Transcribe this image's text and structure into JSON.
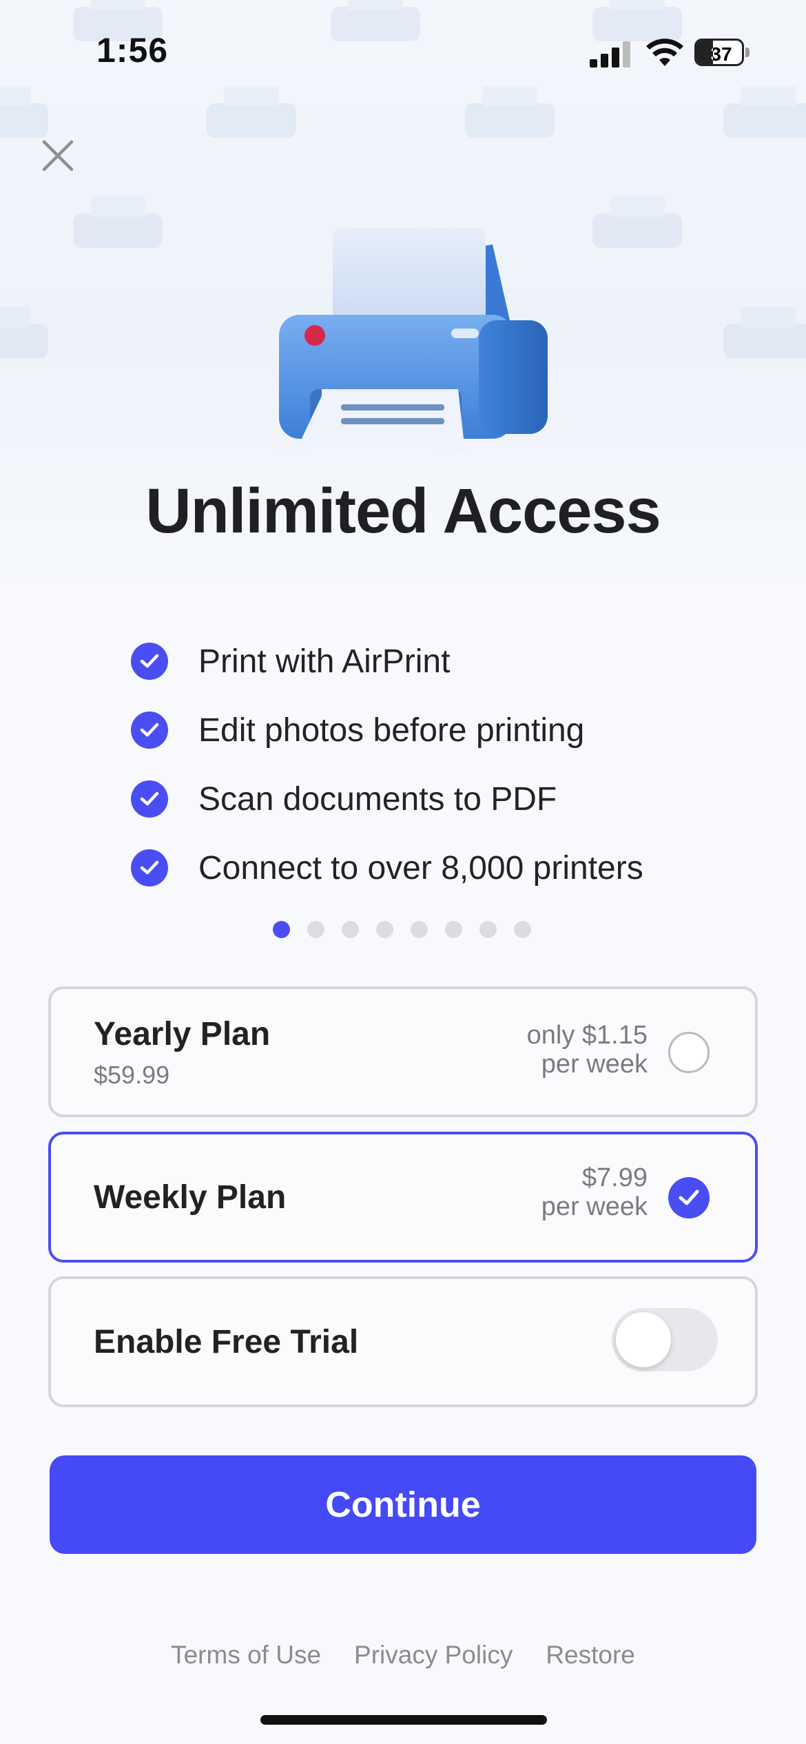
{
  "status_bar": {
    "time": "1:56",
    "battery_level": "37",
    "battery_fraction": 0.37,
    "icons": [
      "cellular-signal-icon",
      "wifi-icon",
      "battery-icon"
    ]
  },
  "close": {
    "icon": "close-icon"
  },
  "hero": {
    "illustration": "printer-icon",
    "title": "Unlimited Access"
  },
  "features": [
    {
      "label": "Print with AirPrint",
      "icon": "check-icon"
    },
    {
      "label": "Edit photos before printing",
      "icon": "check-icon"
    },
    {
      "label": "Scan documents to PDF",
      "icon": "check-icon"
    },
    {
      "label": "Connect to over 8,000 printers",
      "icon": "check-icon"
    }
  ],
  "pagination": {
    "count": 8,
    "active_index": 0
  },
  "plans": {
    "yearly": {
      "name": "Yearly Plan",
      "sub": "$59.99",
      "price_line1": "only $1.15",
      "price_line2": "per week",
      "selected": false
    },
    "weekly": {
      "name": "Weekly Plan",
      "price_line1": "$7.99",
      "price_line2": "per week",
      "selected": true
    },
    "trial": {
      "name": "Enable Free Trial",
      "enabled": false
    }
  },
  "cta": {
    "continue_label": "Continue"
  },
  "footer": {
    "terms": "Terms of Use",
    "privacy": "Privacy Policy",
    "restore": "Restore"
  },
  "colors": {
    "accent": "#4549F6",
    "check": "#4A4EF2",
    "text_primary": "#1F1F24",
    "text_secondary": "#7A7A80",
    "border": "#D6D6DA"
  }
}
